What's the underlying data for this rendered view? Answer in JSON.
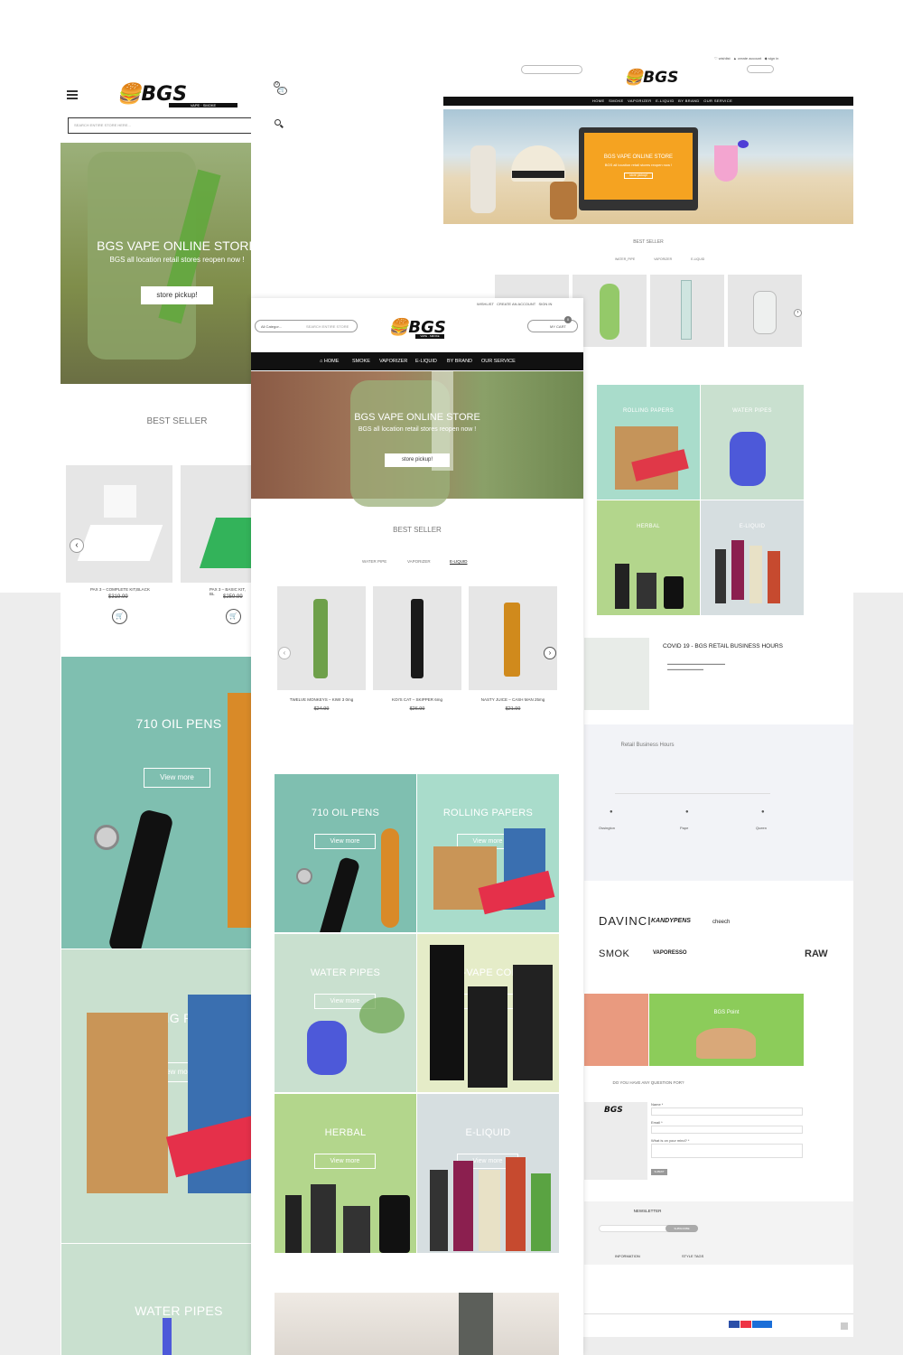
{
  "colors": {
    "black": "#111111",
    "teal": "#7fbfb0",
    "mint": "#a9dccb",
    "sage": "#c9e0cf",
    "lime": "#b3d68c",
    "salmon": "#e99a7f",
    "green": "#8ccc5a",
    "gray": "#d6dee0"
  },
  "mobile": {
    "cart_count": "0",
    "search_placeholder": "SEARCH ENTIRE STORE HERE...",
    "hero": {
      "title": "BGS VAPE ONLINE STORE",
      "subtitle": "BGS all location retail stores reopen now !",
      "button": "store pickup!"
    },
    "best_seller": "BEST SELLER",
    "products": [
      {
        "name": "PAX 3 – COMPLETE KIT,BLACK",
        "price": "$319.99"
      },
      {
        "name": "PAX 3 – BASIC KIT, BL",
        "price": "$259.99"
      }
    ],
    "tiles": [
      {
        "title": "710 OIL PENS",
        "button": "View more"
      },
      {
        "title": "ROLLING PAPERS",
        "button": "View more"
      },
      {
        "title": "WATER PIPES",
        "button": ""
      }
    ]
  },
  "desktop_main": {
    "top_links": [
      "WISHLIST",
      "CREATE AN ACCOUNT",
      "SIGN IN"
    ],
    "category_select": "All Categor...",
    "search_placeholder": "SEARCH ENTIRE STORE",
    "cart_label": "MY CART",
    "cart_count": "0",
    "logo_main": "BGS",
    "logo_sub": "VAPE · SMOKE",
    "nav": [
      "HOME",
      "SMOKE",
      "VAPORIZER",
      "E-LIQUID",
      "BY BRAND",
      "OUR SERVICE"
    ],
    "hero": {
      "title": "BGS VAPE ONLINE STORE",
      "subtitle": "BGS all location retail stores reopen now !",
      "button": "store pickup!"
    },
    "best_seller": "BEST SELLER",
    "tabs": [
      "WATER PIPE",
      "VAPORIZER",
      "E-LIQUID"
    ],
    "products": [
      {
        "name": "TWELVE MONKEYS – KIWI 3 0mg",
        "price": "$24.99"
      },
      {
        "name": "KOI'S CAT – SKIPPER 6mg",
        "price": "$26.99"
      },
      {
        "name": "NASTY JUICE – CASH MAN 25mg",
        "price": "$21.99"
      }
    ],
    "tiles": [
      {
        "title": "710 OIL PENS",
        "button": "View more"
      },
      {
        "title": "ROLLING PAPERS",
        "button": "View more"
      },
      {
        "title": "WATER PIPES",
        "button": "View more"
      },
      {
        "title": "E-VAPE COIL",
        "button": "View more"
      },
      {
        "title": "HERBAL",
        "button": "View more"
      },
      {
        "title": "E-LIQUID",
        "button": "View more"
      }
    ]
  },
  "desktop_right": {
    "hero": {
      "title": "BGS VAPE ONLINE STORE",
      "subtitle": "BGS all location retail stores reopen now !",
      "button": "store pickup!"
    },
    "best_seller": "BEST SELLER",
    "tabs": [
      "WATER PIPE",
      "VAPORIZER",
      "E-LIQUID"
    ],
    "tiles": [
      {
        "title": "ROLLING PAPERS"
      },
      {
        "title": "WATER PIPES"
      },
      {
        "title": "HERBAL"
      },
      {
        "title": "E-LIQUID"
      }
    ],
    "covid_title": "COVID 19 - BGS RETAIL BUSINESS HOURS",
    "hours_title": "Retail Business Hours",
    "locations": [
      "Ossington",
      "Pape",
      "Queen"
    ],
    "brands": [
      "DAVINCI",
      "KANDYPENS",
      "cheech",
      "SMOK",
      "VAPORESSO",
      "RAW"
    ],
    "promo": "BGS Point",
    "question": "DO YOU HAVE ANY QUESTION FOR?",
    "form_labels": [
      "Name *",
      "Email *",
      "What is on your mind? *"
    ],
    "submit": "SUBMIT",
    "newsletter": "NEWSLETTER",
    "subscribe": "SUBSCRIBE",
    "footer_cols": [
      "INFORMATION",
      "STYLE TAGS"
    ]
  }
}
